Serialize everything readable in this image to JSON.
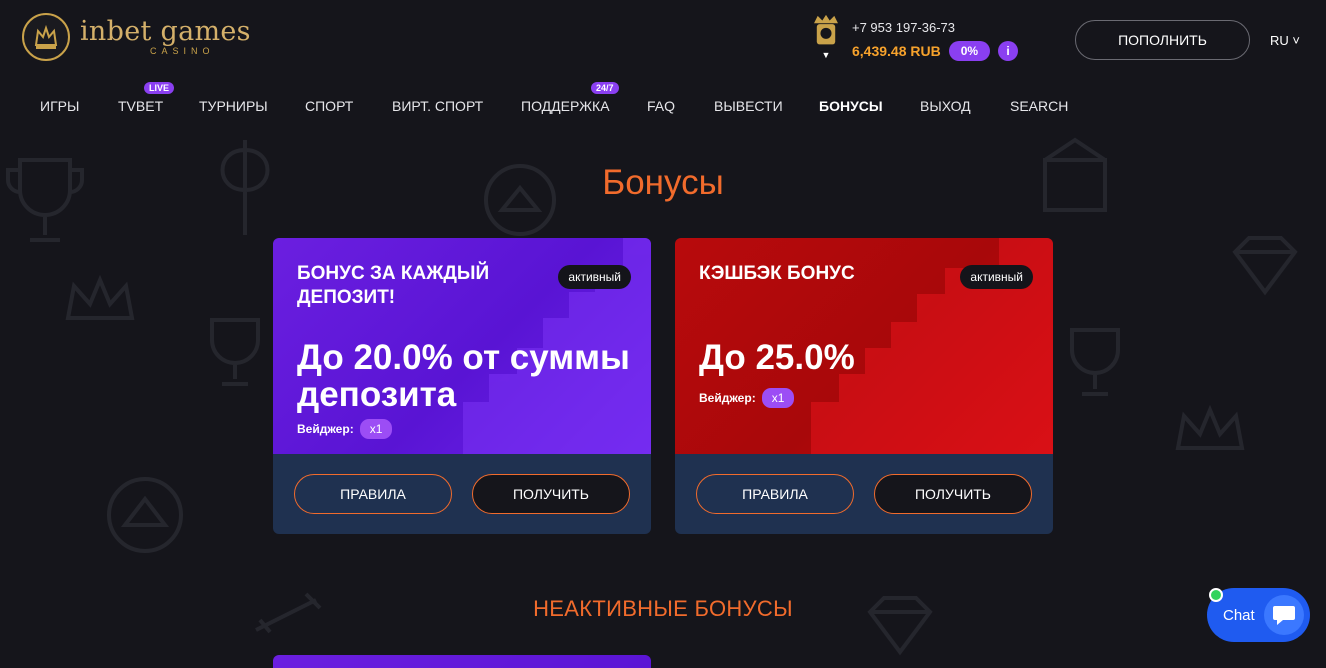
{
  "brand": {
    "name": "inbet games",
    "subtitle": "CASINO",
    "gold": "#c9a24a"
  },
  "user": {
    "phone": "+7 953 197-36-73",
    "balance": "6,439.48 RUB",
    "percent_badge": "0%",
    "info_label": "i"
  },
  "header": {
    "deposit_label": "ПОПОЛНИТЬ",
    "language": "RU ˅"
  },
  "nav": {
    "items": [
      {
        "label": "ИГРЫ"
      },
      {
        "label": "TVBET",
        "badge": "LIVE"
      },
      {
        "label": "ТУРНИРЫ"
      },
      {
        "label": "СПОРТ"
      },
      {
        "label": "ВИРТ. СПОРТ"
      },
      {
        "label": "ПОДДЕРЖКА",
        "badge": "24/7"
      },
      {
        "label": "FAQ"
      },
      {
        "label": "ВЫВЕСТИ"
      },
      {
        "label": "БОНУСЫ",
        "active": true
      },
      {
        "label": "ВЫХОД"
      },
      {
        "label": "SEARCH"
      }
    ]
  },
  "page": {
    "title": "Бонусы",
    "inactive_title": "НЕАКТИВНЫЕ БОНУСЫ"
  },
  "bonuses": [
    {
      "title": "БОНУС ЗА КАЖДЫЙ ДЕПОЗИТ!",
      "status": "активный",
      "amount": "До 20.0% от суммы депозита",
      "wager_label": "Вейджер:",
      "wager_value": "x1",
      "rules_label": "ПРАВИЛА",
      "claim_label": "ПОЛУЧИТЬ",
      "color": "#6b1fe0"
    },
    {
      "title": "КЭШБЭК БОНУС",
      "status": "активный",
      "amount": "До 25.0%",
      "wager_label": "Вейджер:",
      "wager_value": "x1",
      "rules_label": "ПРАВИЛА",
      "claim_label": "ПОЛУЧИТЬ",
      "color": "#b80a0c"
    }
  ],
  "chat": {
    "label": "Chat"
  },
  "colors": {
    "accent": "#f16b2c",
    "balance": "#f7a22c",
    "badge": "#8a3ff1",
    "background": "#15151b",
    "card_bottom": "#1f3150"
  }
}
